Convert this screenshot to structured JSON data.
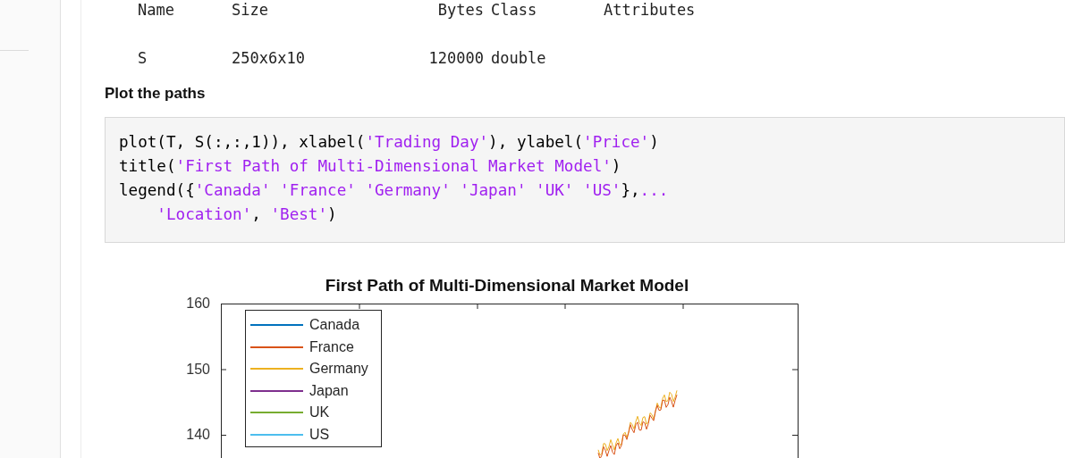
{
  "variables_table": {
    "columns": [
      "Name",
      "Size",
      "Bytes",
      "Class",
      "Attributes"
    ],
    "rows": [
      [
        "S",
        "250x6x10",
        "120000",
        "double",
        ""
      ]
    ]
  },
  "heading": "Plot the paths",
  "code_lines": [
    {
      "continued": false,
      "parts": [
        {
          "kind": "code",
          "text": "plot(T, S(:,:,1)), xlabel("
        },
        {
          "kind": "string",
          "text": "'Trading Day'"
        },
        {
          "kind": "code",
          "text": "), ylabel("
        },
        {
          "kind": "string",
          "text": "'Price'"
        },
        {
          "kind": "code",
          "text": ")"
        }
      ]
    },
    {
      "continued": false,
      "parts": [
        {
          "kind": "code",
          "text": "title("
        },
        {
          "kind": "string",
          "text": "'First Path of Multi-Dimensional Market Model'"
        },
        {
          "kind": "code",
          "text": ")"
        }
      ]
    },
    {
      "continued": false,
      "parts": [
        {
          "kind": "code",
          "text": "legend({"
        },
        {
          "kind": "string",
          "text": "'Canada' 'France' 'Germany' 'Japan' 'UK' 'US'"
        },
        {
          "kind": "code",
          "text": "},"
        },
        {
          "kind": "string",
          "text": "..."
        }
      ]
    },
    {
      "continued": true,
      "parts": [
        {
          "kind": "string",
          "text": "'Location'"
        },
        {
          "kind": "code",
          "text": ", "
        },
        {
          "kind": "string",
          "text": "'Best'"
        },
        {
          "kind": "code",
          "text": ")"
        }
      ]
    }
  ],
  "chart": {
    "title": "First Path of Multi-Dimensional Market Model",
    "yticks": [
      "160",
      "150",
      "140"
    ],
    "legend": [
      {
        "name": "Canada",
        "color": "#0072bd"
      },
      {
        "name": "France",
        "color": "#d95319"
      },
      {
        "name": "Germany",
        "color": "#edb120"
      },
      {
        "name": "Japan",
        "color": "#7e2f8e"
      },
      {
        "name": "UK",
        "color": "#77ac30"
      },
      {
        "name": "US",
        "color": "#4dbeee"
      }
    ]
  }
}
